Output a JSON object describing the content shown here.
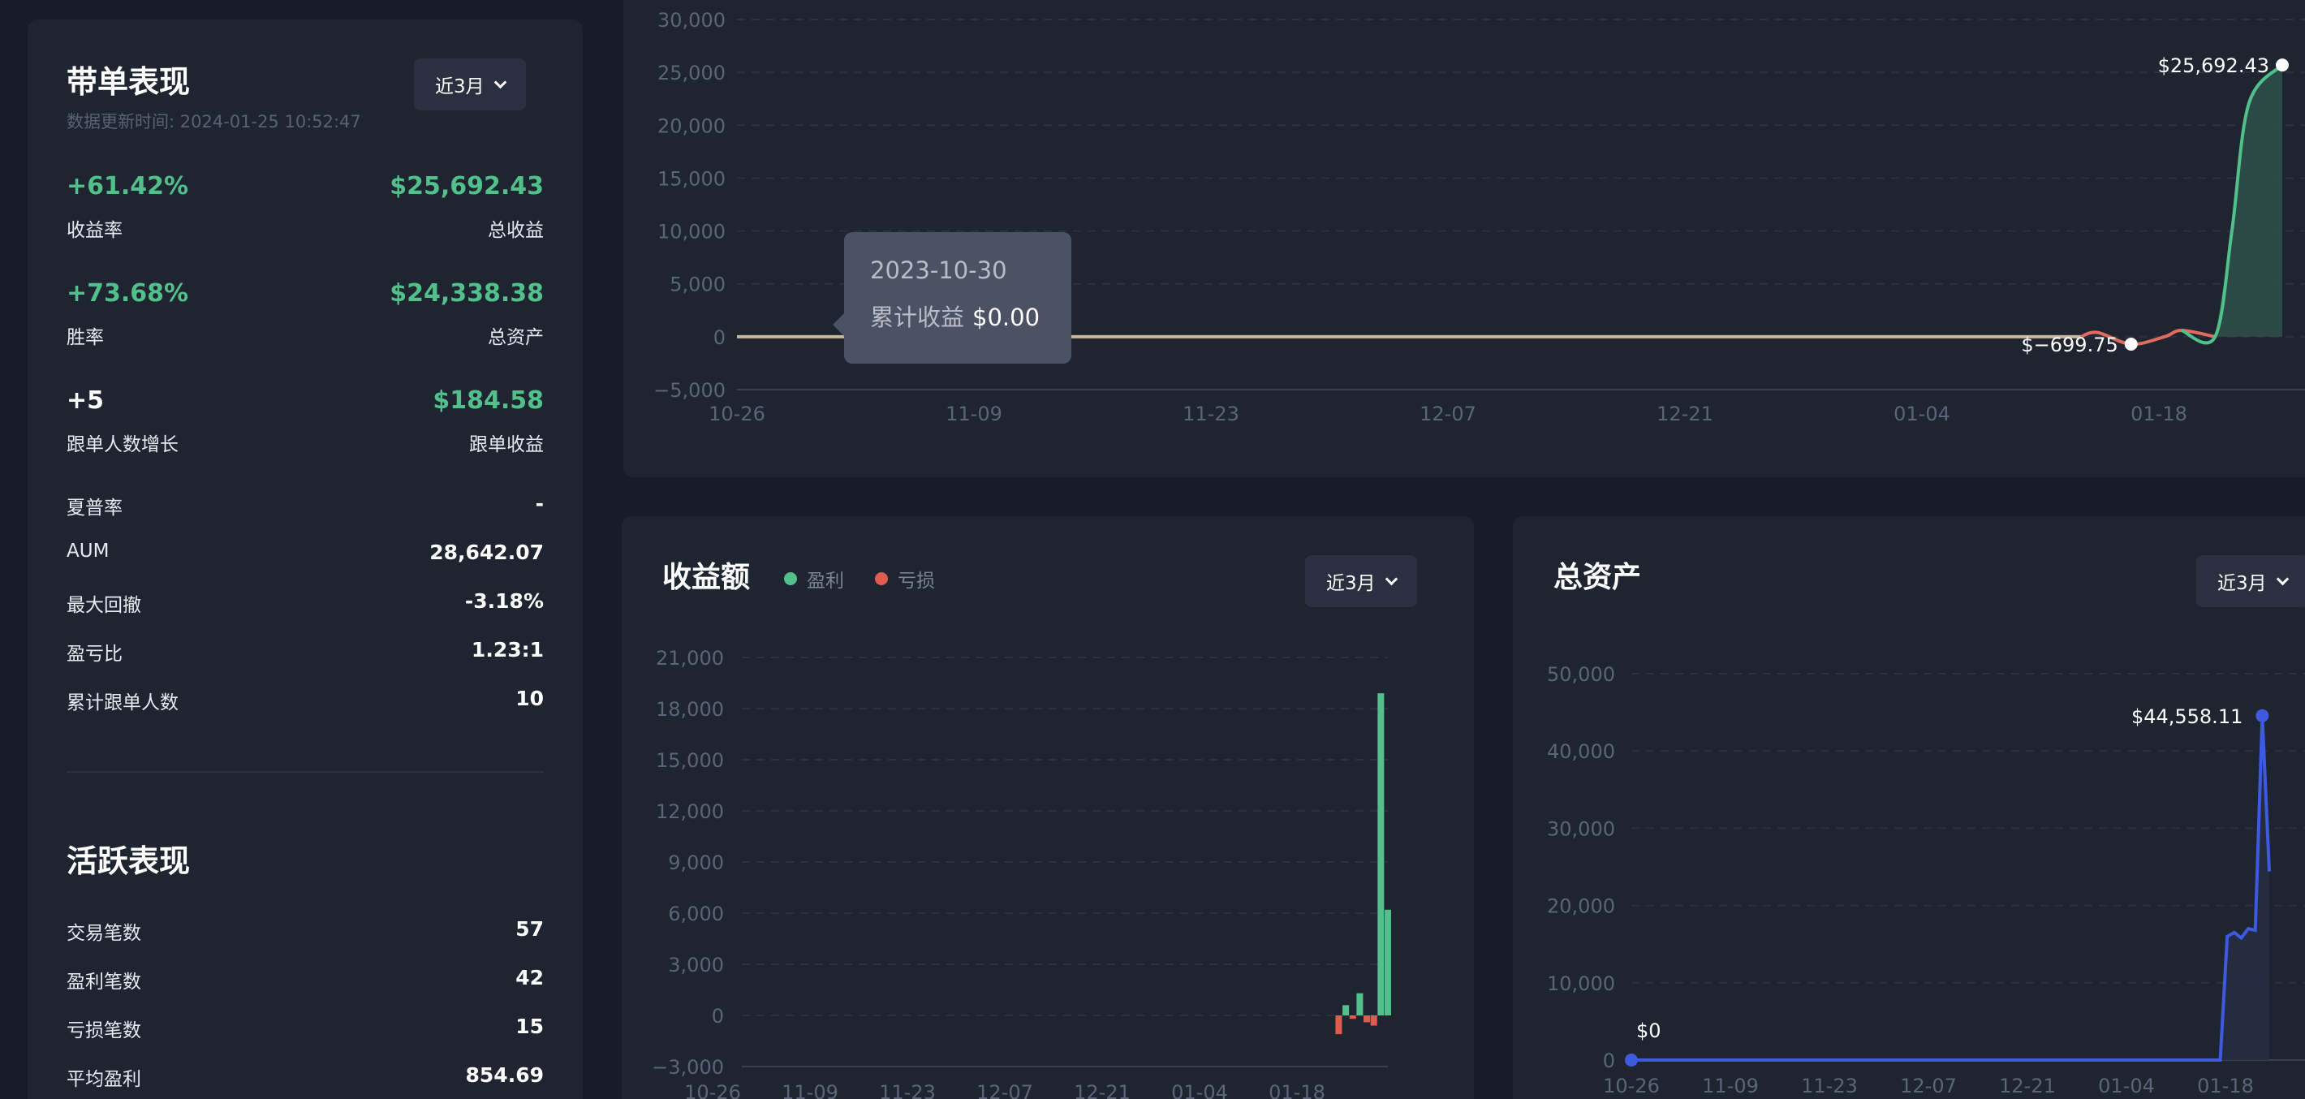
{
  "colors": {
    "background": "#181c28",
    "card": "#1f2431",
    "profit_green": "#52c08a",
    "loss_red": "#e05c4f",
    "asset_blue": "#3d5ae0",
    "tooltip_bg": "#4b5263"
  },
  "left_panel": {
    "title": "带单表现",
    "update_time": "数据更新时间: 2024-01-25 10:52:47",
    "range_button": "近3月",
    "kpis": [
      {
        "value_left": "+61.42%",
        "label_left": "收益率",
        "value_right": "$25,692.43",
        "label_right": "总收益"
      },
      {
        "value_left": "+73.68%",
        "label_left": "胜率",
        "value_right": "$24,338.38",
        "label_right": "总资产"
      },
      {
        "value_left": "+5",
        "label_left": "跟单人数增长",
        "value_right": "$184.58",
        "label_right": "跟单收益"
      }
    ],
    "stats": [
      {
        "label": "夏普率",
        "value": "-"
      },
      {
        "label": "AUM",
        "value": "28,642.07"
      },
      {
        "label": "最大回撤",
        "value": "-3.18%"
      },
      {
        "label": "盈亏比",
        "value": "1.23:1"
      },
      {
        "label": "累计跟单人数",
        "value": "10"
      }
    ],
    "activity_title": "活跃表现",
    "activity": [
      {
        "label": "交易笔数",
        "value": "57"
      },
      {
        "label": "盈利笔数",
        "value": "42"
      },
      {
        "label": "亏损笔数",
        "value": "15"
      },
      {
        "label": "平均盈利",
        "value": "854.69"
      }
    ]
  },
  "tooltip": {
    "date": "2023-10-30",
    "label": "累计收益",
    "value": "$0.00"
  },
  "profit_panel": {
    "title": "收益额",
    "legend_profit": "盈利",
    "legend_loss": "亏损",
    "range_button": "近3月"
  },
  "assets_panel": {
    "title": "总资产",
    "range_button": "近3月"
  },
  "chart_data": [
    {
      "type": "area",
      "name": "cumulative-pnl",
      "x_ticks": [
        "10-26",
        "11-09",
        "11-23",
        "12-07",
        "12-21",
        "01-04",
        "01-18"
      ],
      "y_ticks": [
        "30,000",
        "25,000",
        "20,000",
        "15,000",
        "10,000",
        "5,000",
        "0",
        "−5,000"
      ],
      "ylim": [
        -5000,
        30000
      ],
      "points": [
        {
          "x": 0,
          "y": 0
        },
        {
          "x": 80,
          "y": 0
        },
        {
          "x": 81,
          "y": 400
        },
        {
          "x": 83,
          "y": -699.75
        },
        {
          "x": 85,
          "y": 0
        },
        {
          "x": 86,
          "y": 600
        },
        {
          "x": 88,
          "y": 0
        },
        {
          "x": 89,
          "y": 10000
        },
        {
          "x": 90,
          "y": 22000
        },
        {
          "x": 92,
          "y": 25692.43
        }
      ],
      "annotations": [
        {
          "text": "$25,692.43",
          "x": 92,
          "y": 25692.43
        },
        {
          "text": "$−699.75",
          "x": 83,
          "y": -699.75
        }
      ]
    },
    {
      "type": "bar",
      "name": "daily-pnl",
      "x_ticks": [
        "10-26",
        "11-09",
        "11-23",
        "12-07",
        "12-21",
        "01-04",
        "01-18"
      ],
      "y_ticks": [
        "21,000",
        "18,000",
        "15,000",
        "12,000",
        "9,000",
        "6,000",
        "3,000",
        "0",
        "−3,000"
      ],
      "ylim": [
        -3000,
        21000
      ],
      "x_range": [
        0,
        92
      ],
      "bars": [
        {
          "x": 85,
          "y": -1100
        },
        {
          "x": 86,
          "y": 600
        },
        {
          "x": 87,
          "y": -200
        },
        {
          "x": 88,
          "y": 1300
        },
        {
          "x": 89,
          "y": -400
        },
        {
          "x": 90,
          "y": -600
        },
        {
          "x": 91,
          "y": 18900
        },
        {
          "x": 92,
          "y": 6200
        }
      ]
    },
    {
      "type": "line",
      "name": "total-assets",
      "x_ticks": [
        "10-26",
        "11-09",
        "11-23",
        "12-07",
        "12-21",
        "01-04",
        "01-18"
      ],
      "y_ticks": [
        "50,000",
        "40,000",
        "30,000",
        "20,000",
        "10,000",
        "0"
      ],
      "ylim": [
        0,
        50000
      ],
      "points": [
        {
          "x": 0,
          "y": 0
        },
        {
          "x": 84,
          "y": 0
        },
        {
          "x": 85,
          "y": 16000
        },
        {
          "x": 86,
          "y": 16500
        },
        {
          "x": 87,
          "y": 15800
        },
        {
          "x": 88,
          "y": 17000
        },
        {
          "x": 89,
          "y": 16800
        },
        {
          "x": 90,
          "y": 44558.11
        },
        {
          "x": 91,
          "y": 24400
        }
      ],
      "annotations": [
        {
          "text": "$44,558.11",
          "x": 90,
          "y": 44558.11
        },
        {
          "text": "$0",
          "x": 0,
          "y": 0
        }
      ]
    }
  ]
}
